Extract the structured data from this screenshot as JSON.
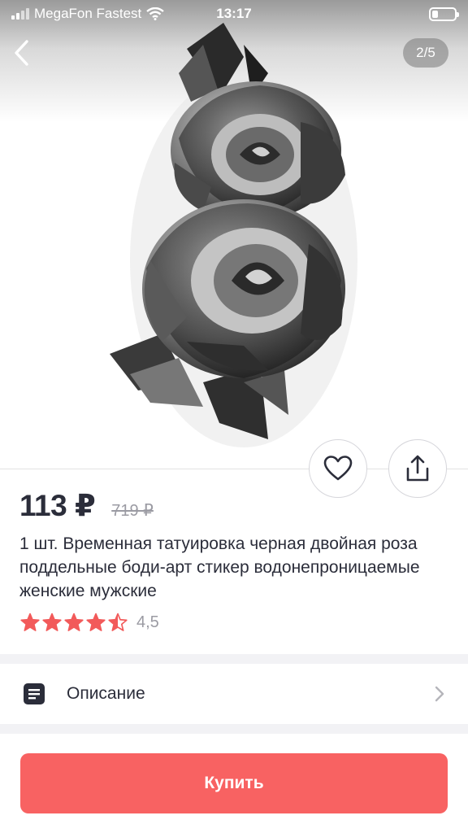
{
  "status_bar": {
    "carrier": "MegaFon Fastest",
    "time": "13:17"
  },
  "gallery": {
    "indicator": "2/5"
  },
  "product": {
    "price": "113 ₽",
    "old_price": "719 ₽",
    "title": "1 шт. Временная татуировка черная двойная роза поддельные боди-арт стикер водонепроницаемые женские мужские",
    "rating_value": "4,5",
    "rating": 4.5,
    "rating_max": 5
  },
  "sections": {
    "description_label": "Описание"
  },
  "actions": {
    "buy_label": "Купить"
  },
  "icons": {
    "back": "chevron-left-icon",
    "favorite": "heart-icon",
    "share": "share-icon",
    "description": "document-icon",
    "open": "chevron-right-icon"
  },
  "colors": {
    "accent": "#f86262",
    "star": "#f25a5a",
    "text": "#2b2d3a",
    "muted": "#9b9ba3"
  }
}
